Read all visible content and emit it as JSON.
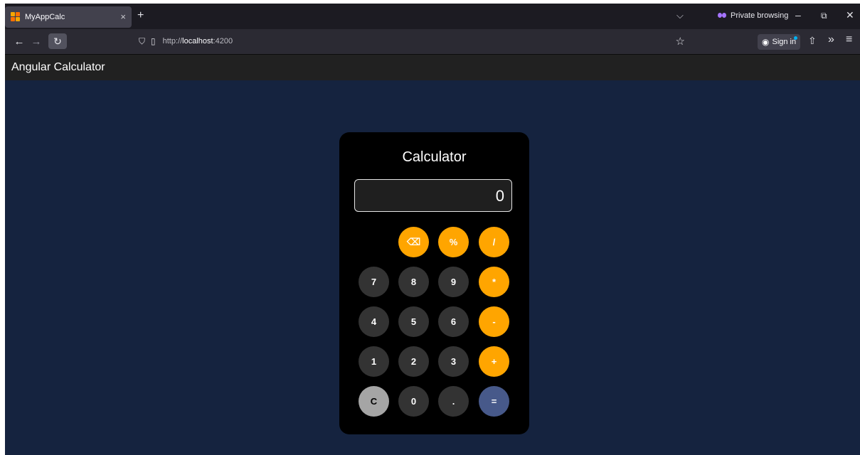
{
  "browser": {
    "tab": {
      "title": "MyAppCalc",
      "close": "×"
    },
    "new_tab": "+",
    "list_all_tabs": "⌵",
    "private_label": "Private browsing",
    "window": {
      "minimize": "–",
      "restore": "⧉",
      "close": "✕"
    },
    "nav": {
      "back": "←",
      "forward": "→",
      "reload": "↻"
    },
    "url": {
      "scheme_host": "http://",
      "host": "localhost",
      "port": ":4200",
      "shield": "⛉",
      "page": "▯",
      "bookmark": "☆"
    },
    "signin": "Sign in",
    "extensions": "⇧",
    "overflow": "»",
    "menu": "≡"
  },
  "app": {
    "title": "Angular Calculator"
  },
  "calculator": {
    "title": "Calculator",
    "display": "0",
    "keys": {
      "backspace": "⌫",
      "percent": "%",
      "divide": "/",
      "seven": "7",
      "eight": "8",
      "nine": "9",
      "multiply": "*",
      "four": "4",
      "five": "5",
      "six": "6",
      "minus": "-",
      "one": "1",
      "two": "2",
      "three": "3",
      "plus": "+",
      "clear": "C",
      "zero": "0",
      "dot": ".",
      "equals": "="
    }
  },
  "colors": {
    "page_bg": "#15233f",
    "operator": "#ffa500",
    "number": "#333333",
    "clear": "#a5a5a5",
    "equals": "#47598a"
  }
}
